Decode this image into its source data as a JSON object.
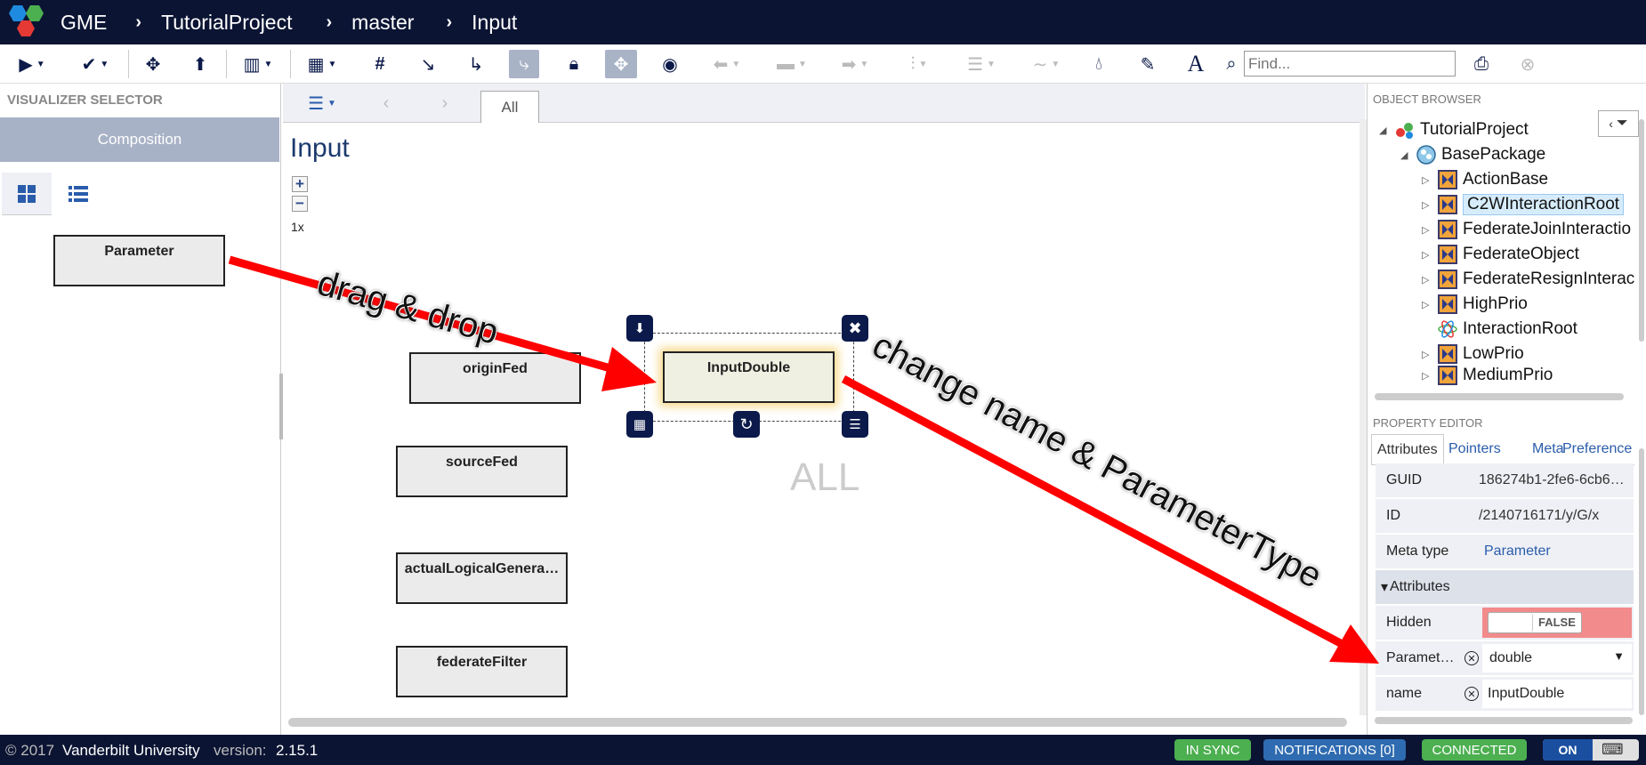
{
  "header": {
    "app_name": "GME",
    "breadcrumbs": [
      "TutorialProject",
      "master",
      "Input"
    ]
  },
  "toolbar": {
    "find_placeholder": "Find..."
  },
  "visualizer_selector": {
    "title": "VISUALIZER SELECTOR",
    "active": "Composition"
  },
  "palette": {
    "items": [
      "Parameter"
    ]
  },
  "canvas": {
    "tab": "All",
    "title": "Input",
    "zoom_level": "1x",
    "watermark": "ALL",
    "elements": [
      "originFed",
      "sourceFed",
      "actualLogicalGenera…",
      "federateFilter"
    ],
    "selected": "InputDouble"
  },
  "annotations": {
    "drag": "drag & drop",
    "change": "change name & ParameterType"
  },
  "object_browser": {
    "title": "OBJECT BROWSER",
    "root": "TutorialProject",
    "package": "BasePackage",
    "items": [
      "ActionBase",
      "C2WInteractionRoot",
      "FederateJoinInteractio",
      "FederateObject",
      "FederateResignInterac",
      "HighPrio",
      "InteractionRoot",
      "LowPrio",
      "MediumPrio"
    ]
  },
  "property_editor": {
    "title": "PROPERTY EDITOR",
    "tabs": [
      "Attributes",
      "Pointers",
      "Meta",
      "Preference"
    ],
    "guid_label": "GUID",
    "guid_value": "186274b1-2fe6-6cb6…",
    "id_label": "ID",
    "id_value": "/2140716171/y/G/x",
    "metatype_label": "Meta type",
    "metatype_value": "Parameter",
    "attributes_section": "Attributes",
    "hidden_label": "Hidden",
    "hidden_value": "FALSE",
    "param_label": "Paramet…",
    "param_value": "double",
    "name_label": "name",
    "name_value": "InputDouble"
  },
  "footer": {
    "copyright": "© 2017",
    "org": "Vanderbilt University",
    "version_label": "version:",
    "version": "2.15.1",
    "in_sync": "IN SYNC",
    "notifications": "NOTIFICATIONS [0]",
    "connected": "CONNECTED",
    "on": "ON"
  },
  "colors": {
    "nav_bg": "#0b1433",
    "accent_blue": "#1c3a6e",
    "status_green": "#4caf50",
    "status_blue": "#2f6bb0",
    "hidden_bg": "#f28b8b",
    "arrow_red": "#ff0000"
  }
}
